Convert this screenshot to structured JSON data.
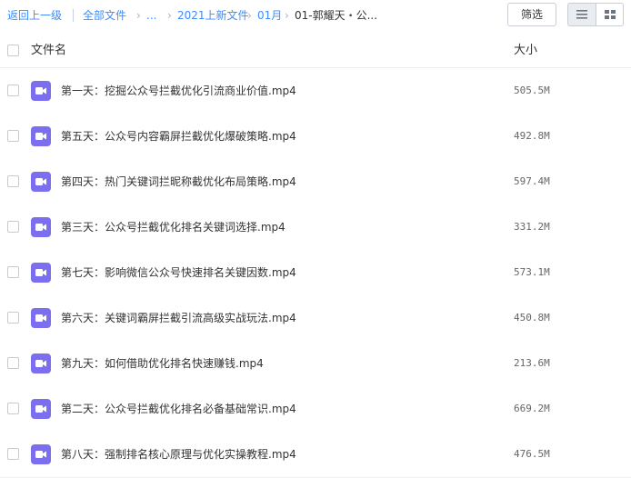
{
  "breadcrumb": {
    "back": "返回上一级",
    "all_files": "全部文件",
    "ellipsis": "...",
    "folder1": "2021上新文件",
    "folder2": "01月",
    "current": "01-郭耀天・公..."
  },
  "toolbar": {
    "filter_label": "筛选",
    "view_mode": "list"
  },
  "table": {
    "headers": {
      "name": "文件名",
      "size": "大小"
    },
    "rows": [
      {
        "name": "第一天：挖掘公众号拦截优化引流商业价值.mp4",
        "size": "505.5M"
      },
      {
        "name": "第五天：公众号内容霸屏拦截优化爆破策略.mp4",
        "size": "492.8M"
      },
      {
        "name": "第四天：热门关键词拦昵称截优化布局策略.mp4",
        "size": "597.4M"
      },
      {
        "name": "第三天：公众号拦截优化排名关键词选择.mp4",
        "size": "331.2M"
      },
      {
        "name": "第七天：影响微信公众号快速排名关键因数.mp4",
        "size": "573.1M"
      },
      {
        "name": "第六天：关键词霸屏拦截引流高级实战玩法.mp4",
        "size": "450.8M"
      },
      {
        "name": "第九天：如何借助优化排名快速赚钱.mp4",
        "size": "213.6M"
      },
      {
        "name": "第二天：公众号拦截优化排名必备基础常识.mp4",
        "size": "669.2M"
      },
      {
        "name": "第八天：强制排名核心原理与优化实操教程.mp4",
        "size": "476.5M"
      }
    ]
  },
  "colors": {
    "link": "#3b8cff",
    "video_icon": "#7b6ff0"
  },
  "icons": {
    "file": "video-file-icon",
    "list_view": "list-view-icon",
    "grid_view": "grid-view-icon"
  }
}
